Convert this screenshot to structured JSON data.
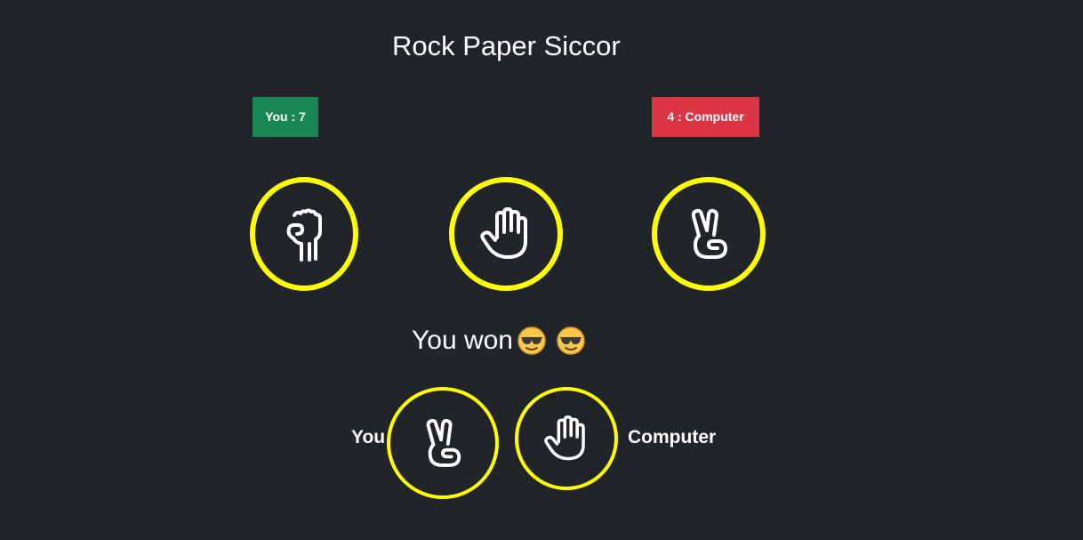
{
  "app": {
    "title": "Rock Paper Siccor"
  },
  "scores": {
    "you_label": "You : 7",
    "computer_label": "4 : Computer"
  },
  "choices": [
    {
      "name": "rock",
      "icon": "fist-icon"
    },
    {
      "name": "paper",
      "icon": "open-hand-icon"
    },
    {
      "name": "scissors",
      "icon": "peace-hand-icon"
    }
  ],
  "result": {
    "message": "You won",
    "emoji": [
      "sunglasses-emoji",
      "sunglasses-emoji"
    ]
  },
  "picks": {
    "you_label": "You",
    "computer_label": "Computer",
    "you_icon": "peace-hand-icon",
    "computer_icon": "open-hand-icon"
  },
  "colors": {
    "background": "#212529",
    "ring": "#ffff00",
    "you_badge": "#198754",
    "computer_badge": "#dc3545"
  }
}
